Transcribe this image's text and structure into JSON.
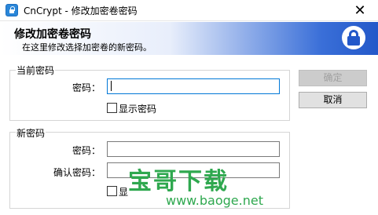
{
  "window": {
    "title": "CnCrypt - 修改加密卷密码",
    "minimize_glyph": "—",
    "close_glyph": "✕"
  },
  "header": {
    "title": "修改加密卷密码",
    "subtitle": "在这里修改选择加密卷的新密码。",
    "icon": "lock-icon"
  },
  "current_group": {
    "label": "当前密码",
    "password_label": "密码：",
    "password_value": "",
    "show_password_label": "显示密码",
    "show_password_checked": false
  },
  "new_group": {
    "label": "新密码",
    "password_label": "密码：",
    "password_value": "",
    "confirm_label": "确认密码：",
    "confirm_value": "",
    "show_password_label_visible": "显"
  },
  "buttons": {
    "ok": "确定",
    "cancel": "取消"
  },
  "watermark": {
    "title": "宝哥下载",
    "url": "www.baoge.net"
  }
}
